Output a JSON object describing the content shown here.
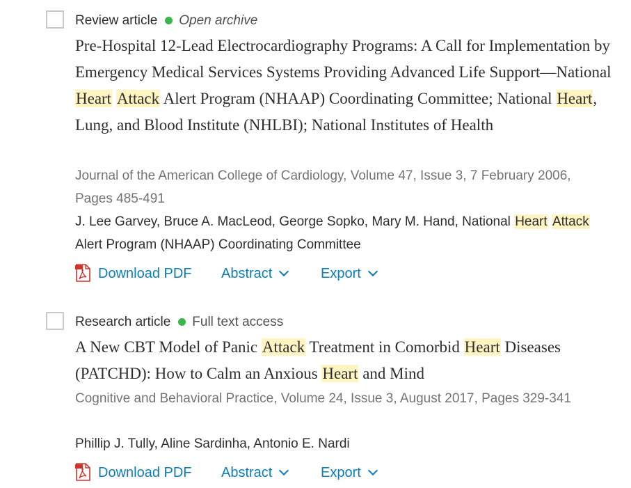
{
  "results": [
    {
      "type": "Review article",
      "access": "Open archive",
      "access_color": "#3cb54a",
      "title_parts": [
        {
          "t": "Pre-Hospital 12-Lead Electrocardiography Programs: A Call for Implementation by Emergency Medical Services Systems Providing Advanced Life Support—National "
        },
        {
          "t": "Heart",
          "hl": true
        },
        {
          "t": " "
        },
        {
          "t": "Attack",
          "hl": true
        },
        {
          "t": " Alert Program (NHAAP) Coordinating Committee; National "
        },
        {
          "t": "Heart",
          "hl": true
        },
        {
          "t": ", Lung, and Blood Institute (NHLBI); National Institutes of Health"
        }
      ],
      "source": "Journal of the American College of Cardiology, Volume 47, Issue 3, 7 February 2006, Pages 485-491",
      "author_parts": [
        {
          "t": "J. Lee Garvey, Bruce A. MacLeod, George Sopko, Mary M. Hand, National "
        },
        {
          "t": "Heart",
          "hl": true
        },
        {
          "t": " "
        },
        {
          "t": "Attack",
          "hl": true
        },
        {
          "t": " Alert Program (NHAAP) Coordinating Committee"
        }
      ],
      "download_label": "Download PDF",
      "abstract_label": "Abstract",
      "export_label": "Export"
    },
    {
      "type": "Research article",
      "access": "Full text access",
      "access_color": "#3cb54a",
      "title_parts": [
        {
          "t": "A New CBT Model of Panic "
        },
        {
          "t": "Attack",
          "hl": true
        },
        {
          "t": " Treatment in Comorbid "
        },
        {
          "t": "Heart",
          "hl": true
        },
        {
          "t": " Diseases (PATCHD): How to Calm an Anxious "
        },
        {
          "t": "Heart",
          "hl": true
        },
        {
          "t": " and Mind"
        }
      ],
      "source": "Cognitive and Behavioral Practice, Volume 24, Issue 3, August 2017, Pages 329-341",
      "author_parts": [
        {
          "t": "Phillip J. Tully, Aline Sardinha, Antonio E. Nardi"
        }
      ],
      "download_label": "Download PDF",
      "abstract_label": "Abstract",
      "export_label": "Export"
    }
  ],
  "colors": {
    "link": "#0c7dbb",
    "highlight": "#fff4c2",
    "source_text": "#737373"
  }
}
